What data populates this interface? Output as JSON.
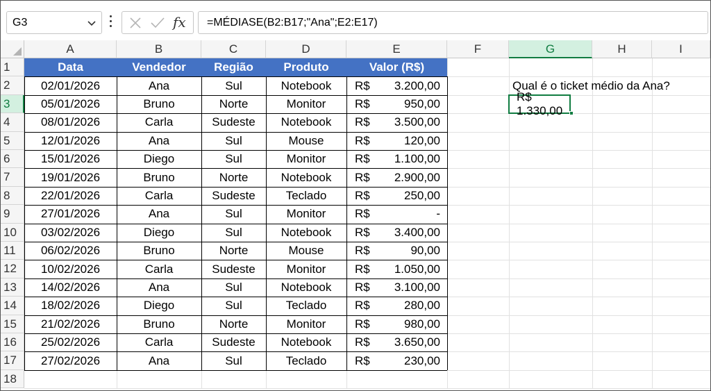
{
  "name_box": {
    "value": "G3"
  },
  "formula_bar": {
    "fx_label": "fx",
    "formula": "=MÉDIASE(B2:B17;\"Ana\";E2:E17)"
  },
  "columns": [
    "A",
    "B",
    "C",
    "D",
    "E",
    "F",
    "G",
    "H",
    "I"
  ],
  "rows": [
    "1",
    "2",
    "3",
    "4",
    "5",
    "6",
    "7",
    "8",
    "9",
    "10",
    "11",
    "12",
    "13",
    "14",
    "15",
    "16",
    "17",
    "18"
  ],
  "table": {
    "headers": [
      "Data",
      "Vendedor",
      "Região",
      "Produto",
      "Valor (R$)"
    ],
    "currency": "R$",
    "records": [
      [
        "02/01/2026",
        "Ana",
        "Sul",
        "Notebook",
        "3.200,00"
      ],
      [
        "05/01/2026",
        "Bruno",
        "Norte",
        "Monitor",
        "950,00"
      ],
      [
        "08/01/2026",
        "Carla",
        "Sudeste",
        "Notebook",
        "3.500,00"
      ],
      [
        "12/01/2026",
        "Ana",
        "Sul",
        "Mouse",
        "120,00"
      ],
      [
        "15/01/2026",
        "Diego",
        "Sul",
        "Monitor",
        "1.100,00"
      ],
      [
        "19/01/2026",
        "Bruno",
        "Norte",
        "Notebook",
        "2.900,00"
      ],
      [
        "22/01/2026",
        "Carla",
        "Sudeste",
        "Teclado",
        "250,00"
      ],
      [
        "27/01/2026",
        "Ana",
        "Sul",
        "Monitor",
        "-"
      ],
      [
        "03/02/2026",
        "Diego",
        "Sul",
        "Notebook",
        "3.400,00"
      ],
      [
        "06/02/2026",
        "Bruno",
        "Norte",
        "Mouse",
        "90,00"
      ],
      [
        "10/02/2026",
        "Carla",
        "Sudeste",
        "Monitor",
        "1.050,00"
      ],
      [
        "14/02/2026",
        "Ana",
        "Sul",
        "Notebook",
        "3.100,00"
      ],
      [
        "18/02/2026",
        "Diego",
        "Sul",
        "Teclado",
        "280,00"
      ],
      [
        "21/02/2026",
        "Bruno",
        "Norte",
        "Monitor",
        "980,00"
      ],
      [
        "25/02/2026",
        "Carla",
        "Sudeste",
        "Notebook",
        "3.650,00"
      ],
      [
        "27/02/2026",
        "Ana",
        "Sul",
        "Teclado",
        "230,00"
      ]
    ]
  },
  "question": {
    "text": "Qual é o ticket médio da Ana?"
  },
  "answer": {
    "value": "R$ 1.330,00"
  },
  "colors": {
    "header_fill": "#4472c4",
    "selection": "#107c41"
  }
}
